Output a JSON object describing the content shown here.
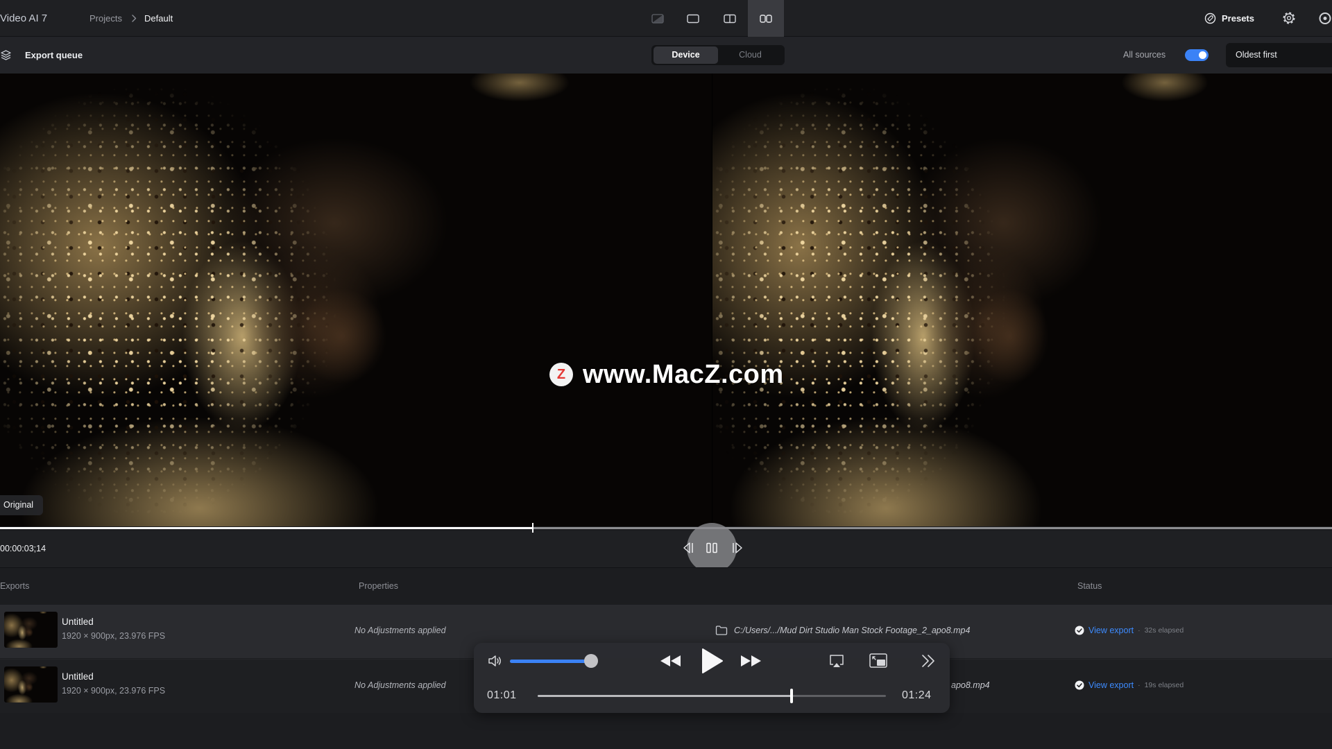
{
  "app": {
    "title": "Video AI 7"
  },
  "breadcrumb": {
    "items": [
      "Projects",
      "Default"
    ]
  },
  "toolbar": {
    "view_modes": [
      {
        "icon": "compare-view-icon",
        "selected": false
      },
      {
        "icon": "single-view-icon",
        "selected": false
      },
      {
        "icon": "split-view-icon",
        "selected": false
      },
      {
        "icon": "side-by-side-view-icon",
        "selected": true
      }
    ],
    "presets_label": "Presets",
    "icons": [
      "presets-icon",
      "gear-icon",
      "profile-icon"
    ]
  },
  "queue": {
    "icon": "layers-icon",
    "title": "Export queue",
    "tabs": [
      "Device",
      "Cloud"
    ],
    "selected_tab": "Device",
    "all_sources_label": "All sources",
    "all_sources_enabled": true,
    "sort_label": "Oldest first"
  },
  "viewer": {
    "original_label": "Original",
    "timecode": "00:00:03;14",
    "playhead_fraction": 0.4,
    "icons": [
      "step-back-icon",
      "pause-icon",
      "step-forward-icon"
    ]
  },
  "watermark": {
    "logo_letter": "Z",
    "text": "www.MacZ.com"
  },
  "exports": {
    "headers": {
      "exports": "Exports",
      "properties": "Properties",
      "status": "Status"
    },
    "status_separator": "·",
    "rows": [
      {
        "name": "Untitled",
        "specs": "1920 × 900px, 23.976 FPS",
        "properties": "No Adjustments applied",
        "path": "C:/Users/.../Mud Dirt Studio Man Stock Footage_2_apo8.mp4",
        "status_link": "View export",
        "elapsed": "32s elapsed"
      },
      {
        "name": "Untitled",
        "specs": "1920 × 900px, 23.976 FPS",
        "properties": "No Adjustments applied",
        "path": "apo8.mp4",
        "status_link": "View export",
        "elapsed": "19s elapsed"
      }
    ]
  },
  "media_controls": {
    "current_time": "01:01",
    "end_time": "01:24",
    "progress_fraction": 0.73,
    "volume_fraction": 1.0,
    "icons": [
      "speaker-icon",
      "rewind-icon",
      "play-icon",
      "fast-forward-icon",
      "airplay-icon",
      "picture-in-picture-icon",
      "chevrons-right-icon"
    ]
  },
  "colors": {
    "accent": "#3b82f6",
    "link": "#3d8bff",
    "watermark_logo": "#e53935",
    "selected_row": "#2a2b2f"
  }
}
